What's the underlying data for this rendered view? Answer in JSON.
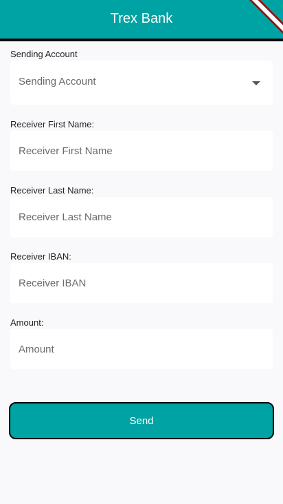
{
  "app": {
    "title": "Trex Bank"
  },
  "form": {
    "sending_account": {
      "label": "Sending Account",
      "placeholder": "Sending Account"
    },
    "first_name": {
      "label": "Receiver First Name:",
      "placeholder": "Receiver First Name"
    },
    "last_name": {
      "label": "Receiver Last Name:",
      "placeholder": "Receiver Last Name"
    },
    "iban": {
      "label": "Receiver IBAN:",
      "placeholder": "Receiver IBAN"
    },
    "amount": {
      "label": "Amount:",
      "placeholder": "Amount"
    }
  },
  "actions": {
    "send_label": "Send"
  },
  "colors": {
    "primary": "#00a3a3",
    "background": "#f9f9fb"
  },
  "icons": {
    "dropdown": "arrow-drop-down-icon"
  }
}
